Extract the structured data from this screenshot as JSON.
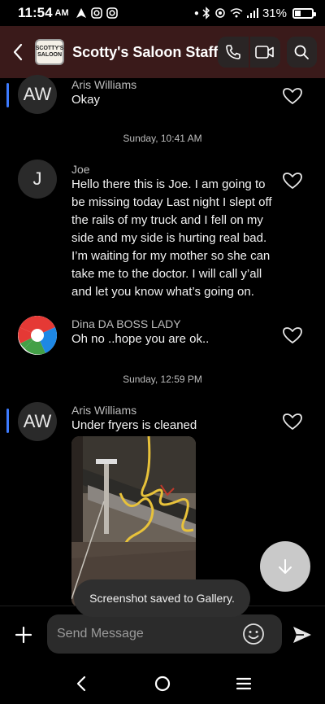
{
  "status_bar": {
    "time": "11:54",
    "ampm": "AM",
    "battery": "31%",
    "battery_level": 0.31
  },
  "header": {
    "logo_text": "SCOTTY'S SALOON",
    "title": "Scotty's Saloon Staff"
  },
  "messages": [
    {
      "avatar": "AW",
      "sender": "Aris Williams",
      "text": "Okay"
    },
    {
      "avatar": "J",
      "sender": "Joe",
      "text": "Hello there this is Joe. I am going to be missing today Last night I slept off the rails of my truck and I fell on my side and my side is hurting real bad. I’m waiting for my mother so she can take me to the doctor. I will call y’all and let you know what’s going on."
    },
    {
      "avatar": "",
      "sender": "Dina DA BOSS LADY",
      "text": "Oh no ..hope you are ok.."
    },
    {
      "avatar": "AW",
      "sender": "Aris Williams",
      "text": "Under fryers is cleaned"
    }
  ],
  "date_separators": [
    "Sunday, 10:41 AM",
    "Sunday, 12:59 PM"
  ],
  "toast": "Screenshot saved to Gallery.",
  "composer": {
    "placeholder": "Send Message"
  },
  "colors": {
    "unread_indicator": "#3d7bff",
    "header_bg": "#3a1a1a"
  }
}
